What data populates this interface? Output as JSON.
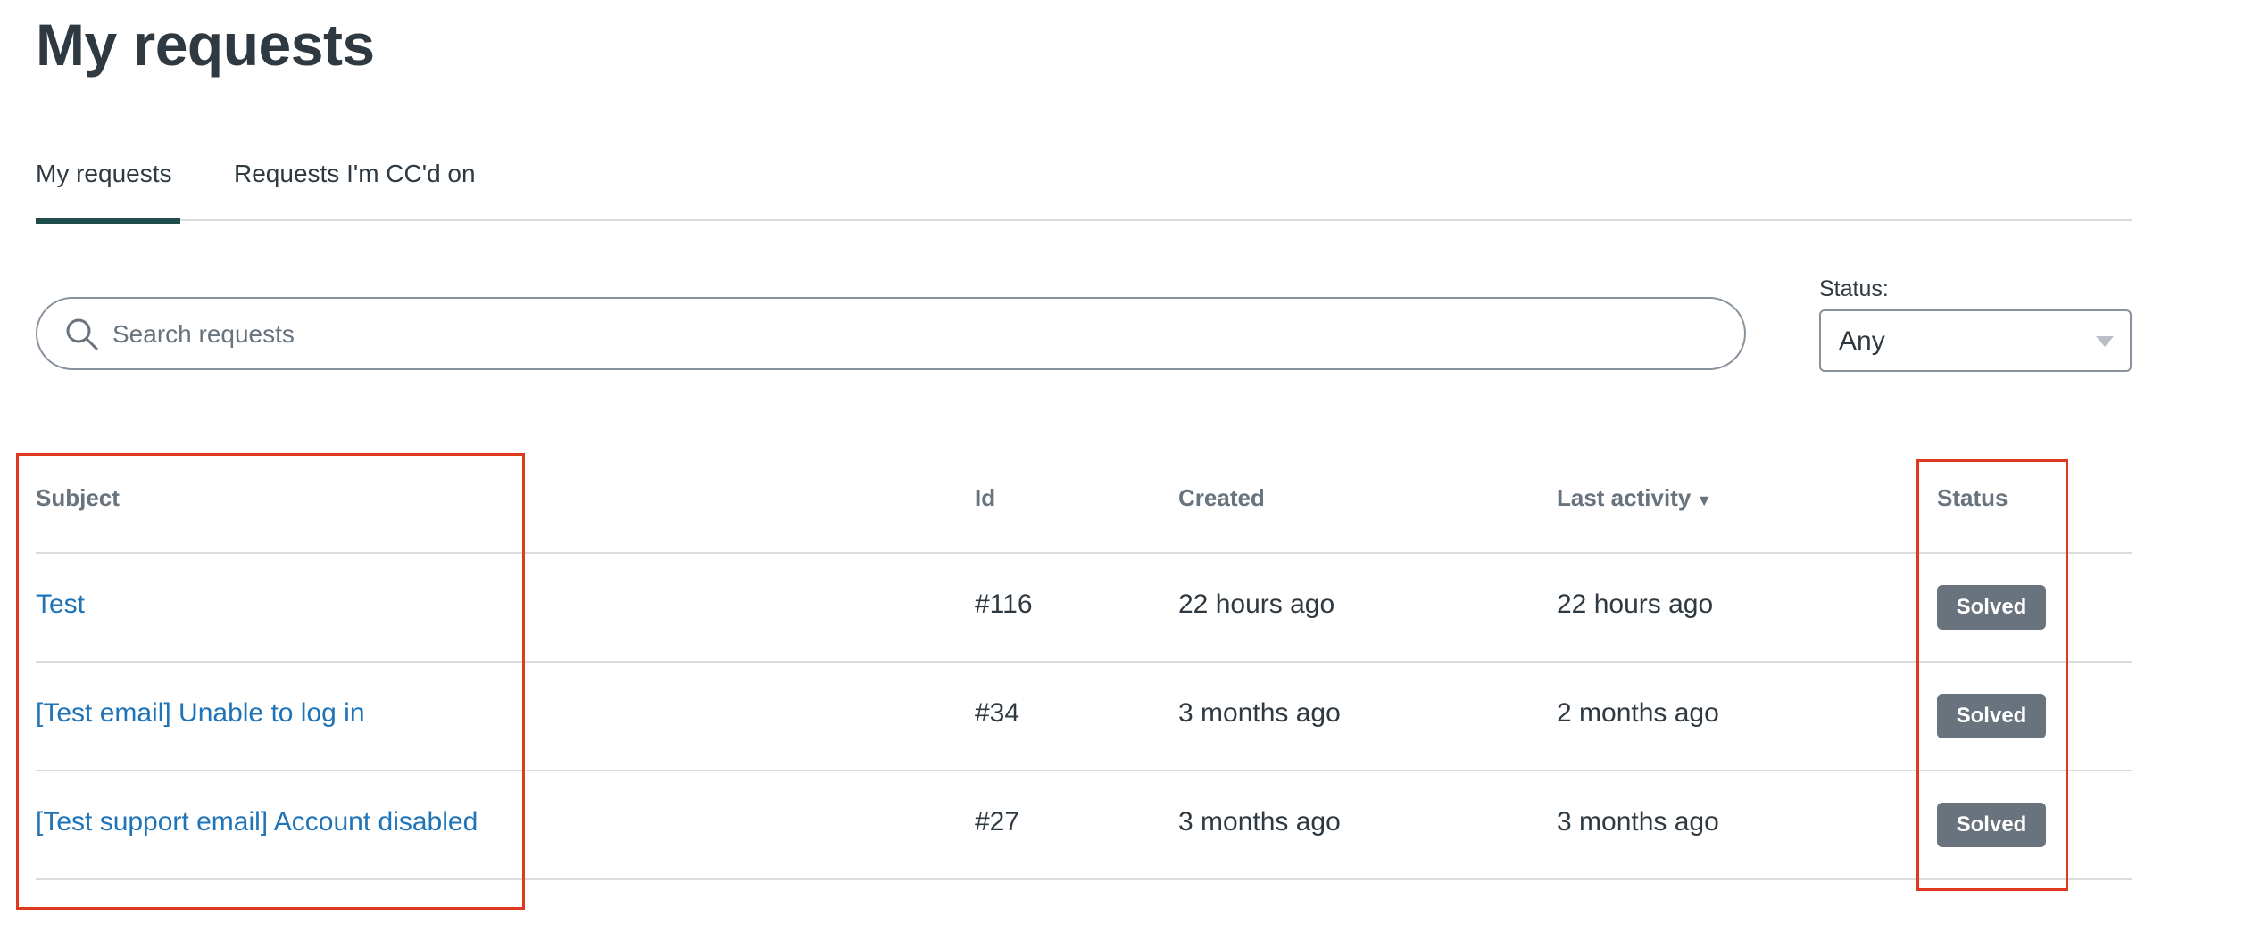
{
  "page": {
    "title": "My requests"
  },
  "tabs": [
    {
      "label": "My requests",
      "active": true
    },
    {
      "label": "Requests I'm CC'd on",
      "active": false
    }
  ],
  "search": {
    "placeholder": "Search requests",
    "value": ""
  },
  "status_filter": {
    "label": "Status:",
    "selected": "Any"
  },
  "table": {
    "headers": {
      "subject": "Subject",
      "id": "Id",
      "created": "Created",
      "last_activity": "Last activity",
      "last_activity_sort": "▼",
      "status": "Status"
    },
    "rows": [
      {
        "subject": "Test",
        "id": "#116",
        "created": "22 hours ago",
        "last_activity": "22 hours ago",
        "status": "Solved"
      },
      {
        "subject": "[Test email] Unable to log in",
        "id": "#34",
        "created": "3 months ago",
        "last_activity": "2 months ago",
        "status": "Solved"
      },
      {
        "subject": "[Test support email] Account disabled",
        "id": "#27",
        "created": "3 months ago",
        "last_activity": "3 months ago",
        "status": "Solved"
      }
    ]
  },
  "colors": {
    "link": "#1f73b7",
    "badge": "#68737d",
    "highlight": "#e03a1e",
    "tab_active": "#1f4b4a"
  },
  "icons": {
    "search": "search-icon",
    "dropdown": "chevron-down-icon",
    "sort": "sort-desc-icon"
  }
}
